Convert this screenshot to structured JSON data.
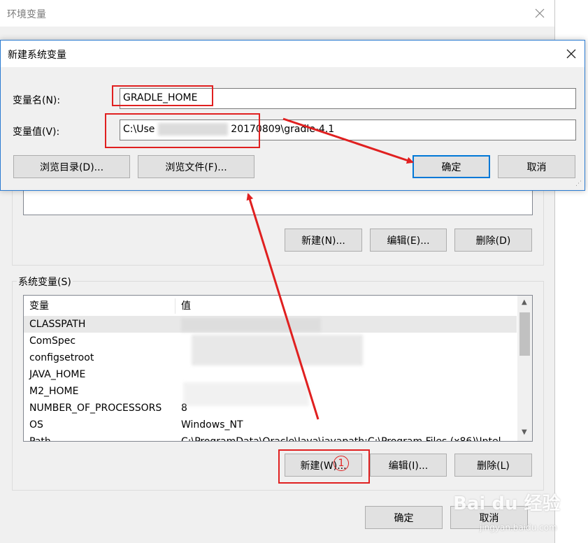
{
  "outer_window": {
    "title": "环境变量",
    "user_vars_buttons": {
      "new": "新建(N)...",
      "edit": "编辑(E)...",
      "delete": "删除(D)"
    },
    "system_group_label": "系统变量(S)",
    "columns": [
      "变量",
      "值"
    ],
    "system_vars": [
      {
        "name": "CLASSPATH",
        "value": ""
      },
      {
        "name": "ComSpec",
        "value": ""
      },
      {
        "name": "configsetroot",
        "value": ""
      },
      {
        "name": "JAVA_HOME",
        "value": ""
      },
      {
        "name": "M2_HOME",
        "value": ""
      },
      {
        "name": "NUMBER_OF_PROCESSORS",
        "value": "8"
      },
      {
        "name": "OS",
        "value": "Windows_NT"
      },
      {
        "name": "Path",
        "value": "C:\\ProgramData\\Oracle\\Java\\javapath;C:\\Program Files (x86)\\Intel"
      }
    ],
    "system_vars_buttons": {
      "new": "新建(W)...",
      "edit": "编辑(I)...",
      "delete": "删除(L)"
    },
    "ok": "确定",
    "cancel": "取消"
  },
  "dialog": {
    "title": "新建系统变量",
    "name_label": "变量名(N):",
    "name_value": "GRADLE_HOME",
    "value_label": "变量值(V):",
    "value_value_start": "C:\\Use",
    "value_value_end": "20170809\\gradle-4.1",
    "browse_dir": "浏览目录(D)...",
    "browse_file": "浏览文件(F)...",
    "ok": "确定",
    "cancel": "取消"
  },
  "annotation": {
    "step_number": "1"
  },
  "watermark": {
    "brand": "Bai du 经验",
    "url": "jingyan.baidu.com"
  },
  "colors": {
    "highlight": "#e02020",
    "focus": "#0078d7",
    "dialog_border": "#2b7bd1"
  }
}
